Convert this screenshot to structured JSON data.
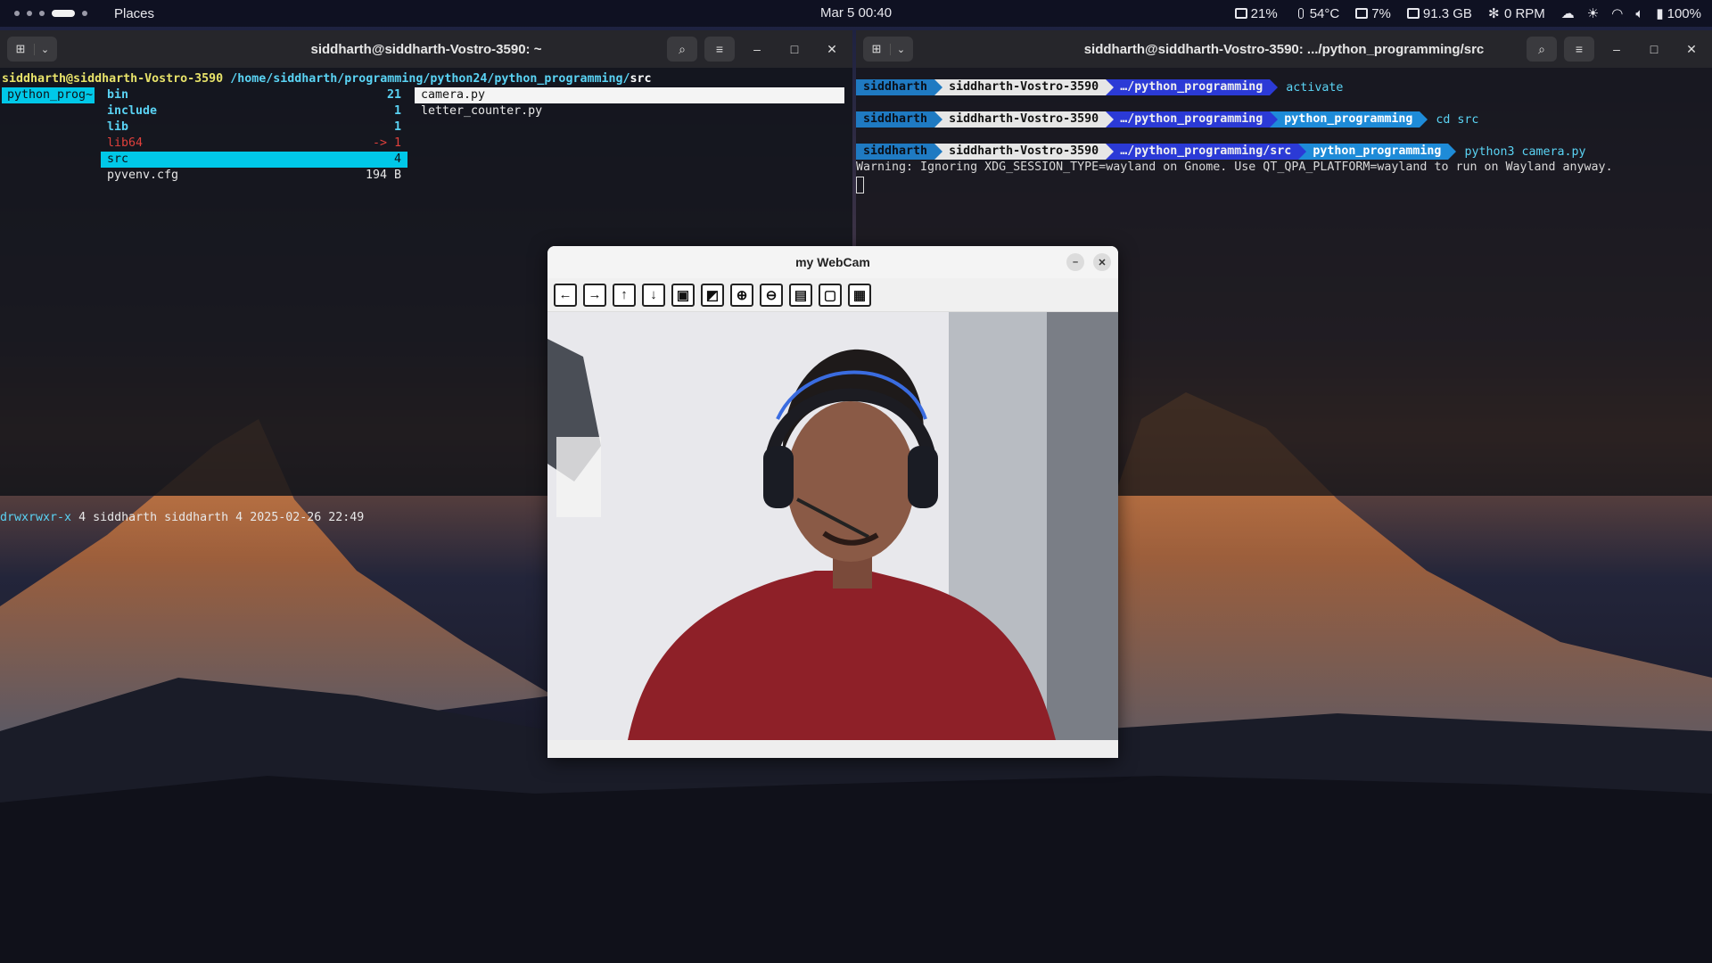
{
  "topbar": {
    "places": "Places",
    "datetime": "Mar 5  00:40",
    "cpu": "21%",
    "temp": "54°C",
    "mem": "7%",
    "disk": "91.3 GB",
    "fan": "0 RPM",
    "battery": "100%"
  },
  "left_terminal": {
    "title": "siddharth@siddharth-Vostro-3590: ~",
    "prompt_user": "siddharth@siddharth-Vostro-3590",
    "prompt_path": "/home/siddharth/programming/python24/python_programming/",
    "prompt_cur": "src",
    "col1_selected": "python_prog~",
    "dirs": [
      {
        "name": "bin",
        "count": "21",
        "kind": "dir"
      },
      {
        "name": "include",
        "count": "1",
        "kind": "dir"
      },
      {
        "name": "lib",
        "count": "1",
        "kind": "dir"
      },
      {
        "name": "lib64",
        "count": "-> 1",
        "kind": "link"
      },
      {
        "name": "src",
        "count": "4",
        "kind": "sel"
      },
      {
        "name": "pyvenv.cfg",
        "count": "194 B",
        "kind": "file"
      }
    ],
    "files": [
      "camera.py",
      "letter_counter.py"
    ],
    "status_perm": "drwxrwxr-x",
    "status_rest": " 4 siddharth siddharth 4 2025-02-26 22:49"
  },
  "right_terminal": {
    "title": "siddharth@siddharth-Vostro-3590: .../python_programming/src",
    "user": "siddharth",
    "host": "siddharth-Vostro-3590",
    "dir1": "…/python_programming",
    "dir3": "…/python_programming/src",
    "venv": "python_programming",
    "cmd1": "activate",
    "cmd2": "cd src",
    "cmd3": "python3 camera.py",
    "warning": "Warning: Ignoring XDG_SESSION_TYPE=wayland on Gnome. Use QT_QPA_PLATFORM=wayland to run on Wayland anyway."
  },
  "webcam": {
    "title": "my WebCam",
    "tools": [
      "arrow-left",
      "arrow-right",
      "arrow-up",
      "arrow-down",
      "image",
      "image-edit",
      "zoom-in",
      "zoom-out",
      "save",
      "copy",
      "properties"
    ]
  }
}
